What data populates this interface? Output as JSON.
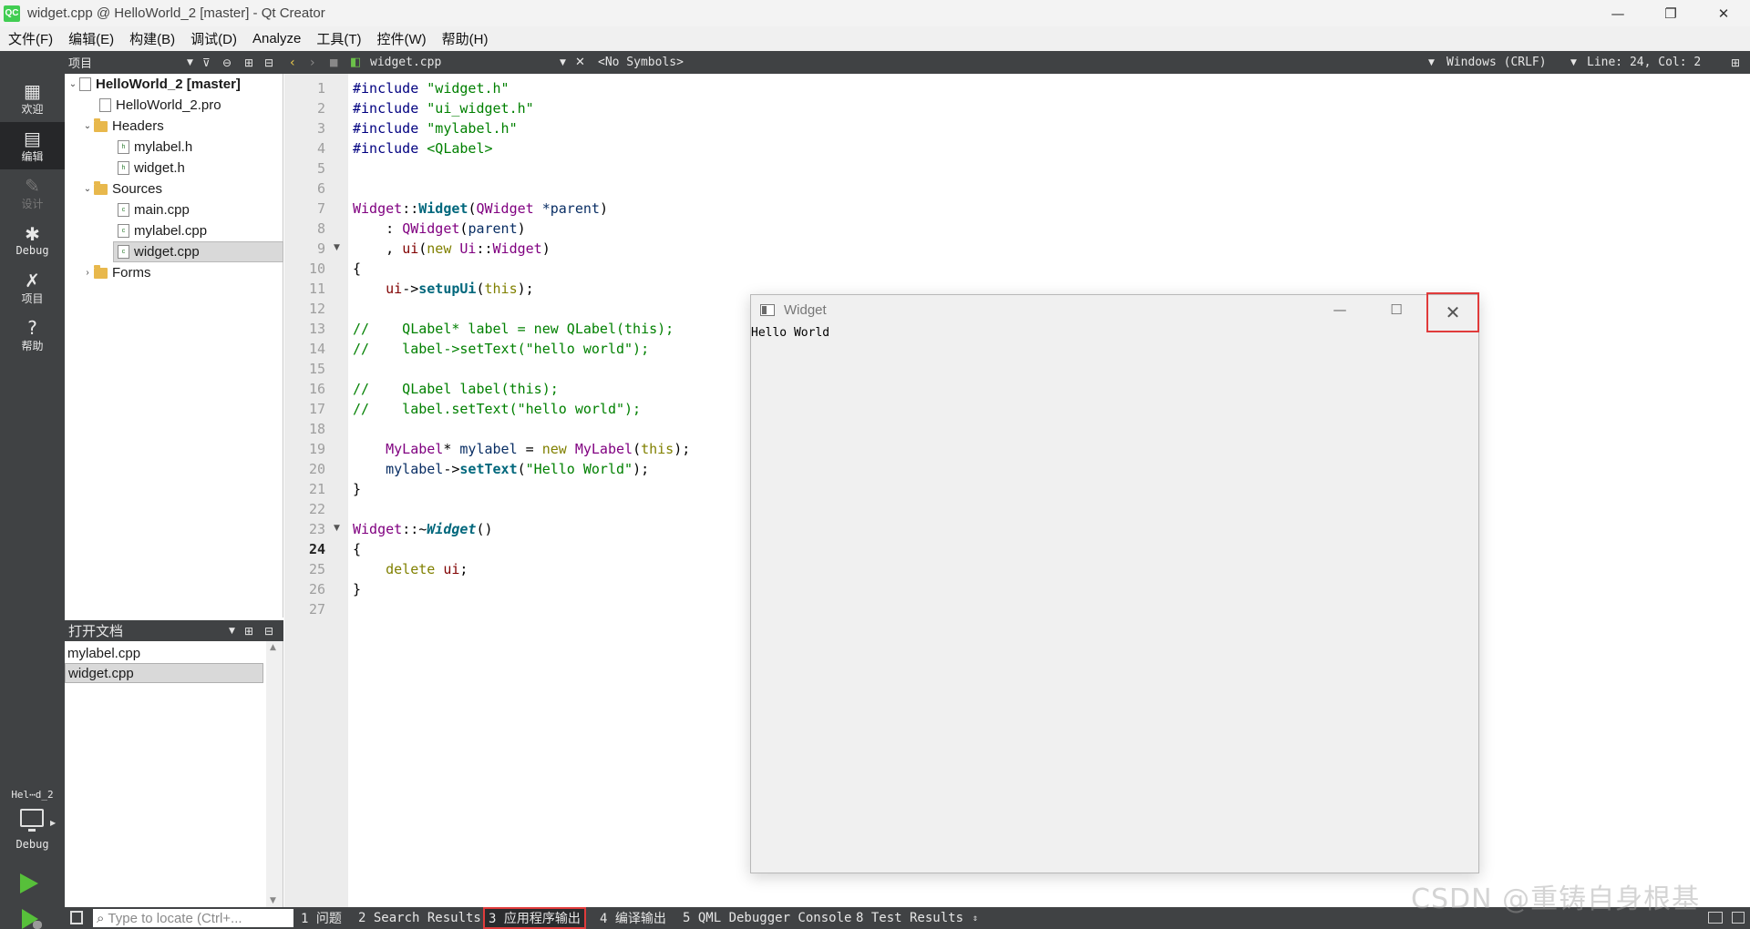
{
  "window": {
    "title": "widget.cpp @ HelloWorld_2 [master] - Qt Creator",
    "logo": "QC",
    "controls": [
      "—",
      "❐",
      "✕"
    ]
  },
  "menu": [
    "文件(F)",
    "编辑(E)",
    "构建(B)",
    "调试(D)",
    "Analyze",
    "工具(T)",
    "控件(W)",
    "帮助(H)"
  ],
  "modes": [
    {
      "label": "欢迎",
      "icon": "grid-icon"
    },
    {
      "label": "编辑",
      "icon": "edit-icon",
      "active": true
    },
    {
      "label": "设计",
      "icon": "pencil-icon",
      "disabled": true
    },
    {
      "label": "Debug",
      "icon": "bug-icon"
    },
    {
      "label": "项目",
      "icon": "wrench-icon"
    },
    {
      "label": "帮助",
      "icon": "help-icon"
    }
  ],
  "kit": {
    "name": "Hel⋯d_2",
    "label": "Debug"
  },
  "toolbar": {
    "project_dropdown": "项目",
    "file_name": "widget.cpp",
    "symbols": "<No Symbols>",
    "line_ending": "Windows (CRLF)",
    "position": "Line: 24, Col: 2"
  },
  "tree": [
    {
      "label": "HelloWorld_2 [master]",
      "depth": 0,
      "expanded": true,
      "kind": "project"
    },
    {
      "label": "HelloWorld_2.pro",
      "depth": 1,
      "kind": "pro"
    },
    {
      "label": "Headers",
      "depth": 1,
      "expanded": true,
      "kind": "folder"
    },
    {
      "label": "mylabel.h",
      "depth": 2,
      "kind": "header"
    },
    {
      "label": "widget.h",
      "depth": 2,
      "kind": "header"
    },
    {
      "label": "Sources",
      "depth": 1,
      "expanded": true,
      "kind": "folder"
    },
    {
      "label": "main.cpp",
      "depth": 2,
      "kind": "source"
    },
    {
      "label": "mylabel.cpp",
      "depth": 2,
      "kind": "source"
    },
    {
      "label": "widget.cpp",
      "depth": 2,
      "kind": "source",
      "selected": true
    },
    {
      "label": "Forms",
      "depth": 1,
      "expanded": false,
      "kind": "folder"
    }
  ],
  "open_docs": {
    "title": "打开文档",
    "items": [
      {
        "label": "mylabel.cpp"
      },
      {
        "label": "widget.cpp",
        "selected": true
      }
    ]
  },
  "editor": {
    "current_line": 24,
    "folds": [
      9,
      23
    ],
    "lines": [
      [
        [
          "pp",
          "#include "
        ],
        [
          "str",
          "\"widget.h\""
        ]
      ],
      [
        [
          "pp",
          "#include "
        ],
        [
          "str",
          "\"ui_widget.h\""
        ]
      ],
      [
        [
          "pp",
          "#include "
        ],
        [
          "str",
          "\"mylabel.h\""
        ]
      ],
      [
        [
          "pp",
          "#include "
        ],
        [
          "str",
          "<QLabel>"
        ]
      ],
      [],
      [],
      [
        [
          "cls",
          "Widget"
        ],
        [
          "",
          "::"
        ],
        [
          "fn",
          "Widget"
        ],
        [
          "",
          "("
        ],
        [
          "cls",
          "QWidget"
        ],
        [
          "",
          ""
        ],
        [
          "var",
          " *parent"
        ],
        [
          "",
          ")"
        ]
      ],
      [
        [
          "",
          "    : "
        ],
        [
          "cls",
          "QWidget"
        ],
        [
          "",
          "("
        ],
        [
          "var",
          "parent"
        ],
        [
          "",
          ")"
        ]
      ],
      [
        [
          "",
          "    , "
        ],
        [
          "mem",
          "ui"
        ],
        [
          "",
          "("
        ],
        [
          "kw",
          "new "
        ],
        [
          "cls",
          "Ui"
        ],
        [
          "",
          "::"
        ],
        [
          "cls",
          "Widget"
        ],
        [
          "",
          ")"
        ]
      ],
      [
        [
          "",
          "{"
        ]
      ],
      [
        [
          "",
          "    "
        ],
        [
          "mem",
          "ui"
        ],
        [
          "",
          "->"
        ],
        [
          "fn",
          "setupUi"
        ],
        [
          "",
          "("
        ],
        [
          "kw",
          "this"
        ],
        [
          "",
          ");"
        ]
      ],
      [],
      [
        [
          "cmt",
          "//    QLabel* label = new QLabel(this);"
        ]
      ],
      [
        [
          "cmt",
          "//    label->setText(\"hello world\");"
        ]
      ],
      [],
      [
        [
          "cmt",
          "//    QLabel label(this);"
        ]
      ],
      [
        [
          "cmt",
          "//    label.setText(\"hello world\");"
        ]
      ],
      [],
      [
        [
          "",
          "    "
        ],
        [
          "cls",
          "MyLabel"
        ],
        [
          "",
          "* "
        ],
        [
          "var",
          "mylabel"
        ],
        [
          "",
          " = "
        ],
        [
          "kw",
          "new "
        ],
        [
          "cls",
          "MyLabel"
        ],
        [
          "",
          "("
        ],
        [
          "kw",
          "this"
        ],
        [
          "",
          ");"
        ]
      ],
      [
        [
          "",
          "    "
        ],
        [
          "var",
          "mylabel"
        ],
        [
          "",
          "->"
        ],
        [
          "fn",
          "setText"
        ],
        [
          "",
          "("
        ],
        [
          "str",
          "\"Hello World\""
        ],
        [
          "",
          ");"
        ]
      ],
      [
        [
          "",
          "}"
        ]
      ],
      [],
      [
        [
          "cls",
          "Widget"
        ],
        [
          "",
          "::~"
        ],
        [
          "fni",
          "Widget"
        ],
        [
          "",
          "()"
        ]
      ],
      [
        [
          "",
          "{"
        ]
      ],
      [
        [
          "",
          "    "
        ],
        [
          "kw",
          "delete "
        ],
        [
          "mem",
          "ui"
        ],
        [
          "",
          ";"
        ]
      ],
      [
        [
          "",
          "}"
        ]
      ],
      []
    ]
  },
  "widget_window": {
    "title": "Widget",
    "label_text": "Hello World",
    "controls": [
      "—",
      "☐",
      "✕"
    ]
  },
  "bottom": {
    "locate_placeholder": "Type to locate (Ctrl+...",
    "tabs": [
      {
        "label": "1 问题"
      },
      {
        "label": "2 Search Results"
      },
      {
        "label": "3 应用程序输出",
        "active": true
      },
      {
        "label": "4 编译输出"
      },
      {
        "label": "5 QML Debugger Console"
      },
      {
        "label": "8 Test Results"
      }
    ]
  },
  "watermark": "CSDN @重铸自身根基"
}
